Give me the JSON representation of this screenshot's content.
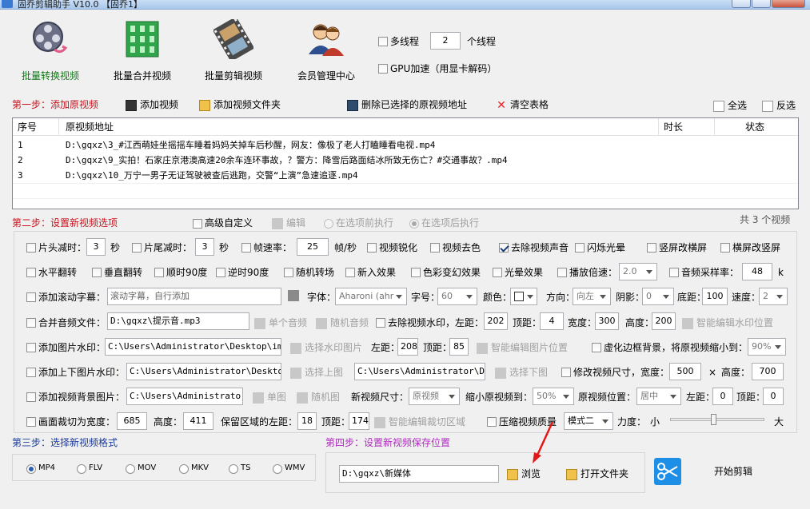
{
  "window": {
    "title": "固乔剪辑助手 V10.0  【固乔1】"
  },
  "toolbar": {
    "items": [
      {
        "label": "批量转换视频",
        "active": true
      },
      {
        "label": "批量合并视频"
      },
      {
        "label": "批量剪辑视频"
      },
      {
        "label": "会员管理中心"
      }
    ],
    "multithread_label": "多线程",
    "thread_count": "2",
    "thread_unit": "个线程",
    "gpu_label": "GPU加速（用显卡解码）"
  },
  "step1": {
    "title": "第一步：添加原视频",
    "add_video": "添加视频",
    "add_folder": "添加视频文件夹",
    "delete_selected": "删除已选择的原视频地址",
    "clear_table": "清空表格",
    "select_all": "全选",
    "invert": "反选"
  },
  "table": {
    "columns": [
      "序号",
      "原视频地址",
      "时长",
      "状态"
    ],
    "rows": [
      {
        "index": "1",
        "path": "D:\\gqxz\\3_#江西萌娃坐摇摇车睡着妈妈关掉车后秒醒，网友：像极了老人打瞌睡看电视.mp4",
        "duration": "",
        "status": ""
      },
      {
        "index": "2",
        "path": "D:\\gqxz\\9_实拍！石家庄京港澳高速20余车连环事故，？警方：降雪后路面结冰所致无伤亡？#交通事故？.mp4",
        "duration": "",
        "status": ""
      },
      {
        "index": "3",
        "path": "D:\\gqxz\\10_万宁一男子无证驾驶被查后逃跑，交警“上演”急速追逐.mp4",
        "duration": "",
        "status": ""
      }
    ]
  },
  "step2": {
    "title": "第二步：设置新视频选项",
    "advanced": "高级自定义",
    "edit": "编辑",
    "before_opt": "在选项前执行",
    "after_opt": "在选项后执行",
    "count_text": "共 3 个视频"
  },
  "options": {
    "head_cut": "片头减时：",
    "head_val": "3",
    "head_unit": "秒",
    "tail_cut": "片尾减时：",
    "tail_val": "3",
    "tail_unit": "秒",
    "fps": "帧速率：",
    "fps_val": "25",
    "fps_unit": "帧/秒",
    "sharpen": "视频锐化",
    "decolor": "视频去色",
    "remove_audio": "去除视频声音",
    "flash": "闪烁光晕",
    "v2h": "竖屏改横屏",
    "h2v": "横屏改竖屏",
    "hflip": "水平翻转",
    "vflip": "垂直翻转",
    "cw90": "顺时90度",
    "ccw90": "逆时90度",
    "rand_trans": "随机转场",
    "new_effect": "新入效果",
    "color_change": "色彩变幻效果",
    "light_effect": "光晕效果",
    "speed": "播放倍速：",
    "speed_val": "2.0",
    "sample_rate": "音频采样率：",
    "sample_val": "48",
    "sample_unit": "k",
    "scroll_sub": "添加滚动字幕：",
    "scroll_sub_placeholder": "滚动字幕，自行添加",
    "font": "字体：",
    "font_val": "Aharoni (ahr",
    "size": "字号：",
    "size_val": "60",
    "color": "颜色：",
    "direction": "方向：",
    "direction_val": "向左",
    "shadow": "阴影：",
    "shadow_val": "0",
    "bottom": "底距：",
    "bottom_val": "100",
    "speed2": "速度：",
    "speed2_val": "2",
    "merge_audio": "合并音频文件：",
    "merge_audio_path": "D:\\gqxz\\提示音.mp3",
    "single_audio": "单个音频",
    "random_audio": "随机音频",
    "remove_wm": "去除视频水印，左距：",
    "wm_left": "202",
    "wm_top_lbl": "顶距：",
    "wm_top": "4",
    "wm_w_lbl": "宽度：",
    "wm_w": "300",
    "wm_h_lbl": "高度：",
    "wm_h": "200",
    "smart_wm": "智能编辑水印位置",
    "img_wm": "添加图片水印：",
    "img_wm_path": "C:\\Users\\Administrator\\Desktop\\img-q",
    "select_wm_img": "选择水印图片",
    "img_left_lbl": "左距：",
    "img_left": "208",
    "img_top_lbl": "顶距：",
    "img_top": "85",
    "smart_img": "智能编辑图片位置",
    "blur_bg": "虚化边框背景，将原视频缩小到：",
    "blur_val": "90%",
    "top_bottom_wm": "添加上下图片水印：",
    "top_img_path": "C:\\Users\\Administrator\\Desktop\\i",
    "select_top": "选择上图",
    "bottom_img_path": "C:\\Users\\Administrator\\Desk",
    "select_bottom": "选择下图",
    "resize": "修改视频尺寸，宽度：",
    "resize_w": "500",
    "times": "×",
    "resize_h_lbl": "高度：",
    "resize_h": "700",
    "bg_img": "添加视频背景图片：",
    "bg_img_path": "C:\\Users\\Administrator\\D",
    "single_img": "单图",
    "random_img": "随机图",
    "new_size": "新视频尺寸：",
    "new_size_val": "原视频",
    "shrink": "缩小原视频到：",
    "shrink_val": "50%",
    "orig_pos": "原视频位置：",
    "orig_pos_val": "居中",
    "bg_left_lbl": "左距：",
    "bg_left": "0",
    "bg_top_lbl": "顶距：",
    "bg_top": "0",
    "crop": "画面裁切为宽度：",
    "crop_w": "685",
    "crop_h_lbl": "高度：",
    "crop_h": "411",
    "keep_left": "保留区域的左距：",
    "keep_left_val": "18",
    "keep_top_lbl": "顶距：",
    "keep_top": "174",
    "smart_crop": "智能编辑裁切区域",
    "compress": "压缩视频质量",
    "compress_mode": "模式二",
    "strength": "力度：",
    "small": "小",
    "large": "大",
    "strength_level": 0.45
  },
  "step3": {
    "title": "第三步：选择新视频格式",
    "formats": [
      "MP4",
      "FLV",
      "MOV",
      "MKV",
      "TS",
      "WMV"
    ],
    "selected": "MP4"
  },
  "step4": {
    "title": "第四步：设置新视频保存位置",
    "path": "D:\\gqxz\\新媒体",
    "browse": "浏览",
    "open_folder": "打开文件夹",
    "start": "开始剪辑"
  }
}
